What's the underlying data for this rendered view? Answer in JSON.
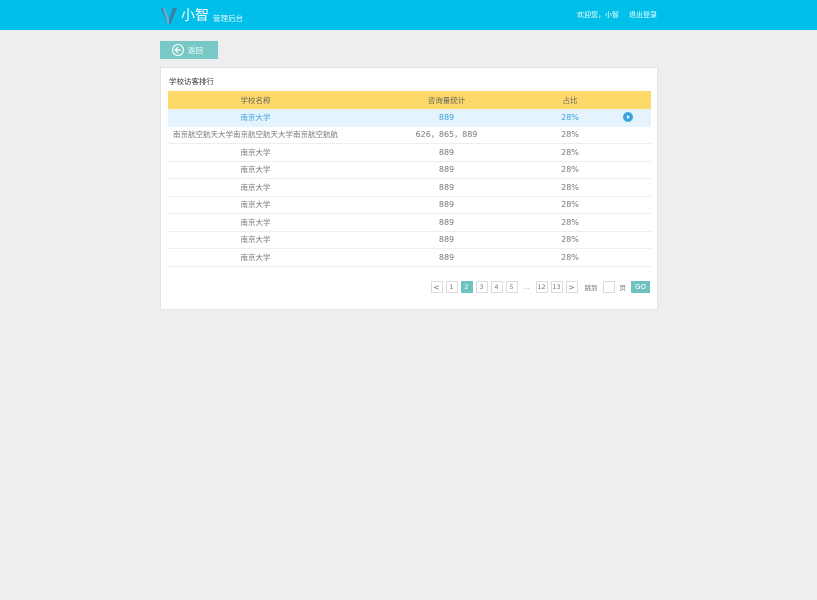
{
  "header": {
    "logo_name": "小智",
    "logo_sub": "管理后台",
    "welcome": "欢迎您，小智",
    "logout": "退出登录"
  },
  "back_label": "返回",
  "card": {
    "title": "学校访客排行",
    "columns": [
      "学校名称",
      "咨询量统计",
      "占比"
    ],
    "rows": [
      {
        "name": "南京大学",
        "count": "889",
        "ratio": "28%"
      },
      {
        "name": "南京航空航天大学南京航空航天大学南京航空航航",
        "count": "626，865，889",
        "ratio": "28%"
      },
      {
        "name": "南京大学",
        "count": "889",
        "ratio": "28%"
      },
      {
        "name": "南京大学",
        "count": "889",
        "ratio": "28%"
      },
      {
        "name": "南京大学",
        "count": "889",
        "ratio": "28%"
      },
      {
        "name": "南京大学",
        "count": "889",
        "ratio": "28%"
      },
      {
        "name": "南京大学",
        "count": "889",
        "ratio": "28%"
      },
      {
        "name": "南京大学",
        "count": "889",
        "ratio": "28%"
      },
      {
        "name": "南京大学",
        "count": "889",
        "ratio": "28%"
      }
    ]
  },
  "pager": {
    "prev": "<",
    "next": ">",
    "pages": [
      "1",
      "2",
      "3",
      "4",
      "5"
    ],
    "ellipsis": "…",
    "last_pages": [
      "12",
      "13"
    ],
    "current": "2",
    "goto_label": "跳到",
    "page_unit": "页",
    "go": "GO"
  },
  "colors": {
    "header": "#00c0ea",
    "table_header": "#fdd969",
    "accent": "#6dc3c1",
    "active_row": "#e4f3fd",
    "link": "#3ea2dd"
  }
}
